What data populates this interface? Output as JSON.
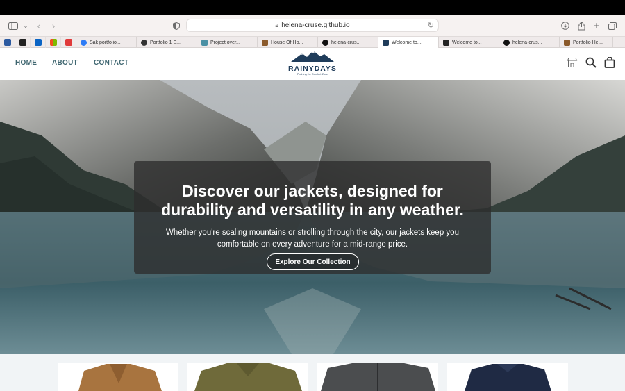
{
  "browser": {
    "url": "helena-cruse.github.io",
    "tabs": [
      {
        "label": "Sak portfolio...",
        "color": "#2e7cf6"
      },
      {
        "label": "Portfolio 1 E...",
        "color": "#333333"
      },
      {
        "label": "Project over...",
        "color": "#4a90a4"
      },
      {
        "label": "House Of Ho...",
        "color": "#8b5a2b"
      },
      {
        "label": "helena-crus...",
        "color": "#111111"
      },
      {
        "label": "Welcome to...",
        "color": "#1f3c5a"
      },
      {
        "label": "Welcome to...",
        "color": "#222222"
      },
      {
        "label": "helena-crus...",
        "color": "#111111"
      },
      {
        "label": "Portfolio Hel...",
        "color": "#8b5a2b"
      }
    ]
  },
  "nav": {
    "home": "HOME",
    "about": "ABOUT",
    "contact": "CONTACT"
  },
  "logo": {
    "name": "RAINYDAYS",
    "tagline": "Pushing the Comfort Zone"
  },
  "hero": {
    "title_line1": "Discover our jackets, designed for",
    "title_line2": "durability and versatility in any weather.",
    "subtitle_line1": "Whether you're scaling mountains or strolling through the city, our jackets keep you",
    "subtitle_line2": "comfortable on every adventure for a mid-range price.",
    "cta": "Explore Our Collection"
  },
  "colors": {
    "nav_link": "#3f6670",
    "brand": "#1f3c5a"
  }
}
